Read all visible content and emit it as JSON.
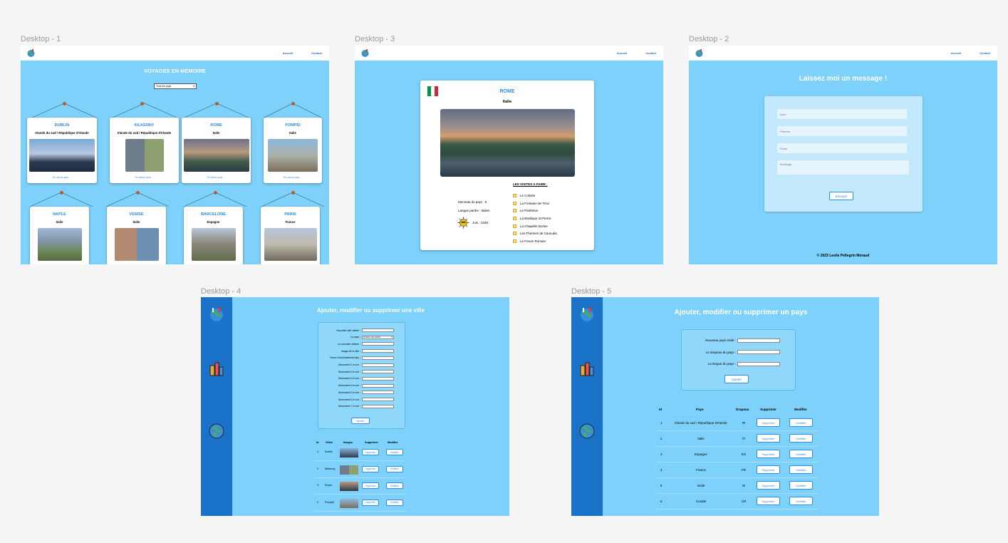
{
  "labels": {
    "d1": "Desktop - 1",
    "d3": "Desktop - 3",
    "d2": "Desktop - 2",
    "d4": "Desktop - 4",
    "d5": "Desktop - 5"
  },
  "nav": {
    "home": "Accueil",
    "contact": "Contact"
  },
  "d1": {
    "title": "VOYAGES EN MÉMOIRE",
    "select": "Tous les pays",
    "more": "En savoir plus ...",
    "cards": [
      {
        "name": "DUBLIN",
        "country": "Irlande du sud / République d'Irlande"
      },
      {
        "name": "KILKENNY",
        "country": "Irlande du sud / République d'Irlande"
      },
      {
        "name": "ROME",
        "country": "Italie"
      },
      {
        "name": "POMPÉI",
        "country": "Italie"
      },
      {
        "name": "NAPLE",
        "country": "Italie"
      },
      {
        "name": "VENISE",
        "country": "Italie"
      },
      {
        "name": "BARCELONE",
        "country": "Espagne"
      },
      {
        "name": "PARIS",
        "country": "France"
      }
    ]
  },
  "d3": {
    "city": "ROME",
    "country": "Italie",
    "visits_title": "LES VISITES A FAIRE :",
    "visits": [
      "Le Colisée",
      "La Fontaine de Trevi",
      "Le Panthéon",
      "La Basilique St Pierre",
      "La Chapelle Sixtine",
      "Les Thermes de Caracala",
      "Le Forum Romain"
    ],
    "currency": "Monnaie du pays : €",
    "language": "Langue parlée : Italien",
    "date": "Juin : 2346"
  },
  "d2": {
    "title": "Laissez moi un message !",
    "fields": [
      "Nom",
      "Prénom",
      "Email",
      "Message"
    ],
    "send": "Envoyer",
    "footer": "© 2023 Leslie Pellegrin Moraud"
  },
  "d4": {
    "title": "Ajouter, modifier ou supprimer une ville",
    "fields": [
      "Nouvelle ville visitée :",
      "Le pays :",
      "La monnaie utilisée :",
      "Image de la ville :",
      "Heure d'enrichissement(e) :",
      "Monument 1 à voir :",
      "Monument 2 à voir :",
      "Monument 3 à voir :",
      "Monument 4 à voir :",
      "Monument 5 à voir :",
      "Monument 6 à voir :",
      "Monument 7 à voir :"
    ],
    "select": "Choisir une option",
    "add": "Ajouter",
    "headers": [
      "Id",
      "Villes",
      "Images",
      "Supprimer",
      "Modifier"
    ],
    "rows": [
      {
        "id": "1",
        "city": "Dublin"
      },
      {
        "id": "2",
        "city": "Kilkenny"
      },
      {
        "id": "3",
        "city": "Rome"
      },
      {
        "id": "4",
        "city": "Pompéi"
      }
    ],
    "del": "Supprimer",
    "mod": "Modifier"
  },
  "d5": {
    "title": "Ajouter, modifier ou supprimer un pays",
    "fields": [
      "Nouveau pays visité :",
      "Le drapeau du pays :",
      "La langue du pays :"
    ],
    "add": "Ajouter",
    "headers": [
      "Id",
      "Pays",
      "Drapeau",
      "Supprimer",
      "Modifier"
    ],
    "rows": [
      {
        "id": "1",
        "country": "Irlande du sud / République d'Irlande",
        "flag": "IR"
      },
      {
        "id": "2",
        "country": "Italie",
        "flag": "IT"
      },
      {
        "id": "3",
        "country": "Espagne",
        "flag": "ES"
      },
      {
        "id": "4",
        "country": "France",
        "flag": "FR"
      },
      {
        "id": "5",
        "country": "Sicile",
        "flag": "SI"
      },
      {
        "id": "6",
        "country": "Croatie",
        "flag": "CR"
      }
    ],
    "del": "Supprimer",
    "mod": "Modifier"
  },
  "colors": {
    "canvas": "#f5f5f5",
    "frame_bg": "#7dd1fa",
    "sidebar": "#1b72c9",
    "accent": "#2d8de6",
    "flag_green": "#009246",
    "flag_red": "#ce2b37"
  },
  "icons": [
    "globe-logo-icon",
    "buildings-icon",
    "world-map-icon",
    "sun-icon",
    "monument-icon"
  ]
}
